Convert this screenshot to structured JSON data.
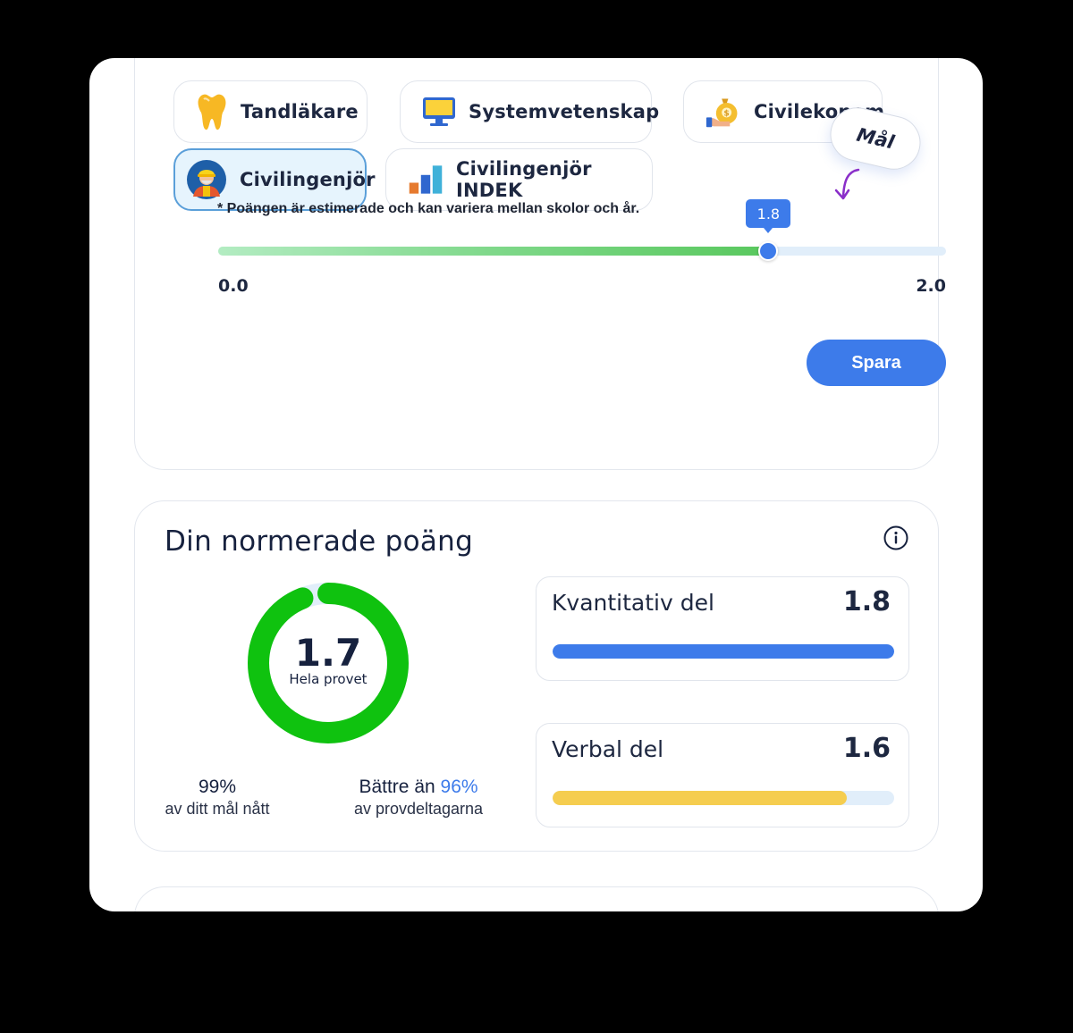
{
  "programs": {
    "row1": [
      {
        "label": "Tandläkare",
        "icon": "tooth-icon"
      },
      {
        "label": "Systemvetenskap",
        "icon": "monitor-icon"
      },
      {
        "label": "Civilekonom",
        "icon": "money-bag-icon"
      }
    ],
    "row2": [
      {
        "label": "Civilingenjör",
        "icon": "engineer-icon",
        "selected": true
      },
      {
        "label": "Civilingenjör INDEK",
        "icon": "bar-chart-icon"
      }
    ]
  },
  "note": "* Poängen är estimerade och kan variera mellan skolor och år.",
  "goal": {
    "bubble_label": "Mål",
    "value_label": "1.8",
    "value": 1.8,
    "min": 0.0,
    "max": 2.0,
    "min_label": "0.0",
    "max_label": "2.0"
  },
  "save_label": "Spara",
  "score": {
    "title": "Din normerade poäng",
    "total_value": "1.7",
    "total_label": "Hela provet",
    "donut_fraction": 0.94,
    "goal_pct": "99%",
    "goal_text": "av ditt mål nått",
    "better_prefix": "Bättre än ",
    "better_pct": "96%",
    "better_text": "av provdeltagarna",
    "parts": [
      {
        "label": "Kvantitativ del",
        "value": "1.8",
        "fraction": 1.0,
        "color": "#3d7bea"
      },
      {
        "label": "Verbal del",
        "value": "1.6",
        "fraction": 0.86,
        "color": "#f5cd4f"
      }
    ]
  },
  "colors": {
    "accent": "#3d7bea",
    "donut": "#0fc20f",
    "donut_track": "#e1eefa"
  }
}
